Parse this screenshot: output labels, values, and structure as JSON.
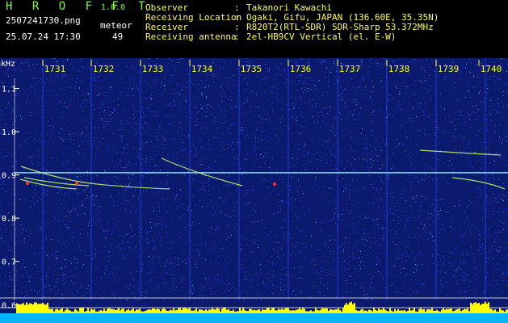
{
  "header": {
    "app_title": "H R O F F T",
    "version": "1.0.0",
    "filename": "2507241730.png",
    "datetime": "25.07.24 17:30",
    "meteor_label": "meteor",
    "meteor_count": "49",
    "info": [
      {
        "key": "Observer",
        "value": "Takanori Kawachi"
      },
      {
        "key": "Receiving Location",
        "value": "Ogaki, Gifu, JAPAN (136.60E, 35.35N)"
      },
      {
        "key": "Receiver",
        "value": "R820T2(RTL-SDR) SDR-Sharp 53.372MHz"
      },
      {
        "key": "Receiving antenna",
        "value": "2el-HB9CV Vertical (el. E-W)"
      }
    ]
  },
  "chart_data": {
    "type": "heatmap",
    "ylabel": "kHz",
    "x_ticks": [
      "1731",
      "1732",
      "1733",
      "1734",
      "1735",
      "1736",
      "1737",
      "1738",
      "1739",
      "1740"
    ],
    "y_ticks": [
      "1.1",
      "1.0",
      "0.9",
      "0.8",
      "0.7",
      "0.6"
    ],
    "y_values": [
      1.1,
      1.0,
      0.9,
      0.8,
      0.7,
      0.6
    ],
    "ylim": [
      0.58,
      1.17
    ],
    "colors": {
      "background": "#0c1a6e",
      "noise": [
        "#1f3bff",
        "#2e63ff",
        "#00c8ff",
        "#1a2fcf"
      ],
      "carrier": "#9cf0ff",
      "meteor_trail": "#c8ff6a",
      "meteor_head": "#ff3030",
      "tick": "#ffff00",
      "baseline_fill": "#00b4ff",
      "baseline_peaks": "#ffff00"
    }
  }
}
